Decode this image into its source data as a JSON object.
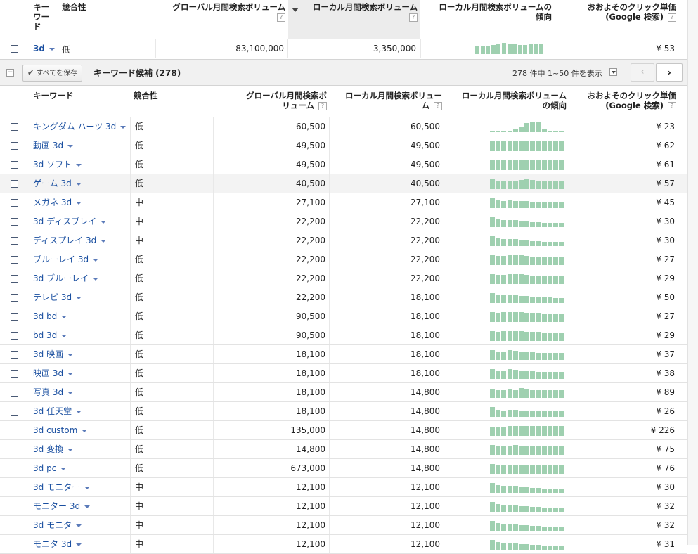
{
  "colors": {
    "link": "#1a4fa0",
    "sparkline": "#9fd0b0",
    "sorted_header_bg": "#ececec"
  },
  "top_header": {
    "keyword": "キー\nワー\nド",
    "competition": "競合性",
    "global": "グローバル月間検索ボリューム",
    "local": "ローカル月間検索ボリューム",
    "trend": "ローカル月間検索ボリュームの\n傾向",
    "cpc": "おおよそのクリック単価\n(Google 検索)",
    "help": "?"
  },
  "searched_row": {
    "keyword": "3d",
    "competition": "低",
    "global": "83,100,000",
    "local": "3,350,000",
    "cpc": "¥ 53",
    "trend": [
      0.7,
      0.7,
      0.7,
      0.8,
      0.9,
      1.0,
      0.9,
      0.9,
      0.8,
      0.8,
      0.85,
      0.85,
      0.85
    ]
  },
  "toolbar": {
    "save_all": "すべてを保存",
    "section_title": "キーワード候補 (278)",
    "pagination_text": "278 件中 1~50 件を表示"
  },
  "table_header": {
    "keyword": "キーワード",
    "competition": "競合性",
    "global": "グローバル月間検索ボ\nリューム",
    "local": "ローカル月間検索ボリュー\nム",
    "trend": "ローカル月間検索ボリューム\nの傾向",
    "cpc": "おおよそのクリック単価\n(Google 検索)",
    "help": "?"
  },
  "rows": [
    {
      "keyword": "キングダム ハーツ 3d",
      "competition": "低",
      "global": "60,500",
      "local": "60,500",
      "cpc": "¥ 23",
      "trend": [
        0.05,
        0.05,
        0.08,
        0.1,
        0.3,
        0.45,
        0.8,
        0.9,
        0.9,
        0.3,
        0.15,
        0.08,
        0.05
      ]
    },
    {
      "keyword": "動画 3d",
      "competition": "低",
      "global": "49,500",
      "local": "49,500",
      "cpc": "¥ 62",
      "trend": [
        0.9,
        0.9,
        0.9,
        0.9,
        0.9,
        0.9,
        0.9,
        0.9,
        0.9,
        0.9,
        0.9,
        0.9,
        0.9
      ]
    },
    {
      "keyword": "3d ソフト",
      "competition": "低",
      "global": "49,500",
      "local": "49,500",
      "cpc": "¥ 61",
      "trend": [
        0.9,
        0.9,
        0.9,
        0.9,
        0.9,
        0.9,
        0.9,
        0.9,
        0.9,
        0.9,
        0.9,
        0.9,
        0.9
      ]
    },
    {
      "keyword": "ゲーム 3d",
      "competition": "低",
      "global": "40,500",
      "local": "40,500",
      "cpc": "¥ 57",
      "trend": [
        0.85,
        0.75,
        0.75,
        0.75,
        0.75,
        0.8,
        0.85,
        0.8,
        0.75,
        0.75,
        0.75,
        0.75,
        0.75
      ]
    },
    {
      "keyword": "メガネ 3d",
      "competition": "中",
      "global": "27,100",
      "local": "27,100",
      "cpc": "¥ 45",
      "trend": [
        0.9,
        0.75,
        0.65,
        0.7,
        0.65,
        0.6,
        0.6,
        0.55,
        0.55,
        0.5,
        0.5,
        0.5,
        0.5
      ]
    },
    {
      "keyword": "3d ディスプレイ",
      "competition": "中",
      "global": "22,200",
      "local": "22,200",
      "cpc": "¥ 30",
      "trend": [
        0.9,
        0.7,
        0.6,
        0.65,
        0.6,
        0.5,
        0.5,
        0.45,
        0.45,
        0.4,
        0.4,
        0.35,
        0.35
      ]
    },
    {
      "keyword": "ディスプレイ 3d",
      "competition": "中",
      "global": "22,200",
      "local": "22,200",
      "cpc": "¥ 30",
      "trend": [
        0.9,
        0.7,
        0.6,
        0.65,
        0.6,
        0.5,
        0.5,
        0.45,
        0.45,
        0.4,
        0.4,
        0.35,
        0.35
      ]
    },
    {
      "keyword": "ブルーレイ 3d",
      "competition": "低",
      "global": "22,200",
      "local": "22,200",
      "cpc": "¥ 27",
      "trend": [
        0.85,
        0.8,
        0.8,
        0.85,
        0.9,
        0.85,
        0.8,
        0.75,
        0.75,
        0.7,
        0.7,
        0.7,
        0.7
      ]
    },
    {
      "keyword": "3d ブルーレイ",
      "competition": "低",
      "global": "22,200",
      "local": "22,200",
      "cpc": "¥ 29",
      "trend": [
        0.85,
        0.8,
        0.8,
        0.85,
        0.9,
        0.85,
        0.8,
        0.75,
        0.75,
        0.7,
        0.7,
        0.7,
        0.7
      ]
    },
    {
      "keyword": "テレビ 3d",
      "competition": "低",
      "global": "22,200",
      "local": "18,100",
      "cpc": "¥ 50",
      "trend": [
        0.9,
        0.75,
        0.7,
        0.75,
        0.7,
        0.6,
        0.6,
        0.55,
        0.55,
        0.5,
        0.5,
        0.45,
        0.45
      ]
    },
    {
      "keyword": "3d bd",
      "competition": "低",
      "global": "90,500",
      "local": "18,100",
      "cpc": "¥ 27",
      "trend": [
        0.85,
        0.8,
        0.85,
        0.85,
        0.85,
        0.85,
        0.8,
        0.8,
        0.8,
        0.75,
        0.75,
        0.75,
        0.75
      ]
    },
    {
      "keyword": "bd 3d",
      "competition": "低",
      "global": "90,500",
      "local": "18,100",
      "cpc": "¥ 29",
      "trend": [
        0.85,
        0.8,
        0.85,
        0.85,
        0.85,
        0.85,
        0.8,
        0.8,
        0.8,
        0.75,
        0.75,
        0.75,
        0.75
      ]
    },
    {
      "keyword": "3d 映画",
      "competition": "低",
      "global": "18,100",
      "local": "18,100",
      "cpc": "¥ 37",
      "trend": [
        0.85,
        0.7,
        0.75,
        0.85,
        0.8,
        0.75,
        0.7,
        0.7,
        0.65,
        0.65,
        0.6,
        0.6,
        0.6
      ]
    },
    {
      "keyword": "映画 3d",
      "competition": "低",
      "global": "18,100",
      "local": "18,100",
      "cpc": "¥ 38",
      "trend": [
        0.85,
        0.7,
        0.75,
        0.85,
        0.8,
        0.75,
        0.7,
        0.7,
        0.65,
        0.65,
        0.6,
        0.6,
        0.6
      ]
    },
    {
      "keyword": "写真 3d",
      "competition": "低",
      "global": "18,100",
      "local": "14,800",
      "cpc": "¥ 89",
      "trend": [
        0.8,
        0.7,
        0.7,
        0.75,
        0.7,
        0.9,
        0.75,
        0.7,
        0.7,
        0.7,
        0.7,
        0.7,
        0.7
      ]
    },
    {
      "keyword": "3d 任天堂",
      "competition": "低",
      "global": "18,100",
      "local": "14,800",
      "cpc": "¥ 26",
      "trend": [
        0.85,
        0.6,
        0.55,
        0.6,
        0.65,
        0.5,
        0.55,
        0.5,
        0.55,
        0.5,
        0.5,
        0.5,
        0.5
      ]
    },
    {
      "keyword": "3d custom",
      "competition": "低",
      "global": "135,000",
      "local": "14,800",
      "cpc": "¥ 226",
      "trend": [
        0.8,
        0.75,
        0.8,
        0.85,
        0.9,
        0.85,
        0.85,
        0.85,
        0.85,
        0.85,
        0.85,
        0.85,
        0.85
      ]
    },
    {
      "keyword": "3d 変換",
      "competition": "低",
      "global": "14,800",
      "local": "14,800",
      "cpc": "¥ 75",
      "trend": [
        0.9,
        0.8,
        0.75,
        0.8,
        0.85,
        0.8,
        0.75,
        0.75,
        0.75,
        0.75,
        0.75,
        0.75,
        0.75
      ]
    },
    {
      "keyword": "3d pc",
      "competition": "低",
      "global": "673,000",
      "local": "14,800",
      "cpc": "¥ 76",
      "trend": [
        0.85,
        0.8,
        0.75,
        0.8,
        0.8,
        0.75,
        0.75,
        0.75,
        0.75,
        0.75,
        0.75,
        0.75,
        0.75
      ]
    },
    {
      "keyword": "3d モニター",
      "competition": "中",
      "global": "12,100",
      "local": "12,100",
      "cpc": "¥ 30",
      "trend": [
        0.85,
        0.7,
        0.6,
        0.65,
        0.6,
        0.5,
        0.5,
        0.45,
        0.45,
        0.4,
        0.4,
        0.35,
        0.35
      ]
    },
    {
      "keyword": "モニター 3d",
      "competition": "中",
      "global": "12,100",
      "local": "12,100",
      "cpc": "¥ 32",
      "trend": [
        0.85,
        0.7,
        0.6,
        0.65,
        0.6,
        0.5,
        0.5,
        0.45,
        0.45,
        0.4,
        0.4,
        0.35,
        0.35
      ]
    },
    {
      "keyword": "3d モニタ",
      "competition": "中",
      "global": "12,100",
      "local": "12,100",
      "cpc": "¥ 32",
      "trend": [
        0.85,
        0.7,
        0.6,
        0.65,
        0.6,
        0.5,
        0.5,
        0.45,
        0.45,
        0.4,
        0.4,
        0.35,
        0.35
      ]
    },
    {
      "keyword": "モニタ 3d",
      "competition": "中",
      "global": "12,100",
      "local": "12,100",
      "cpc": "¥ 31",
      "trend": [
        0.85,
        0.7,
        0.6,
        0.65,
        0.6,
        0.5,
        0.5,
        0.45,
        0.45,
        0.4,
        0.4,
        0.35,
        0.35
      ]
    }
  ]
}
